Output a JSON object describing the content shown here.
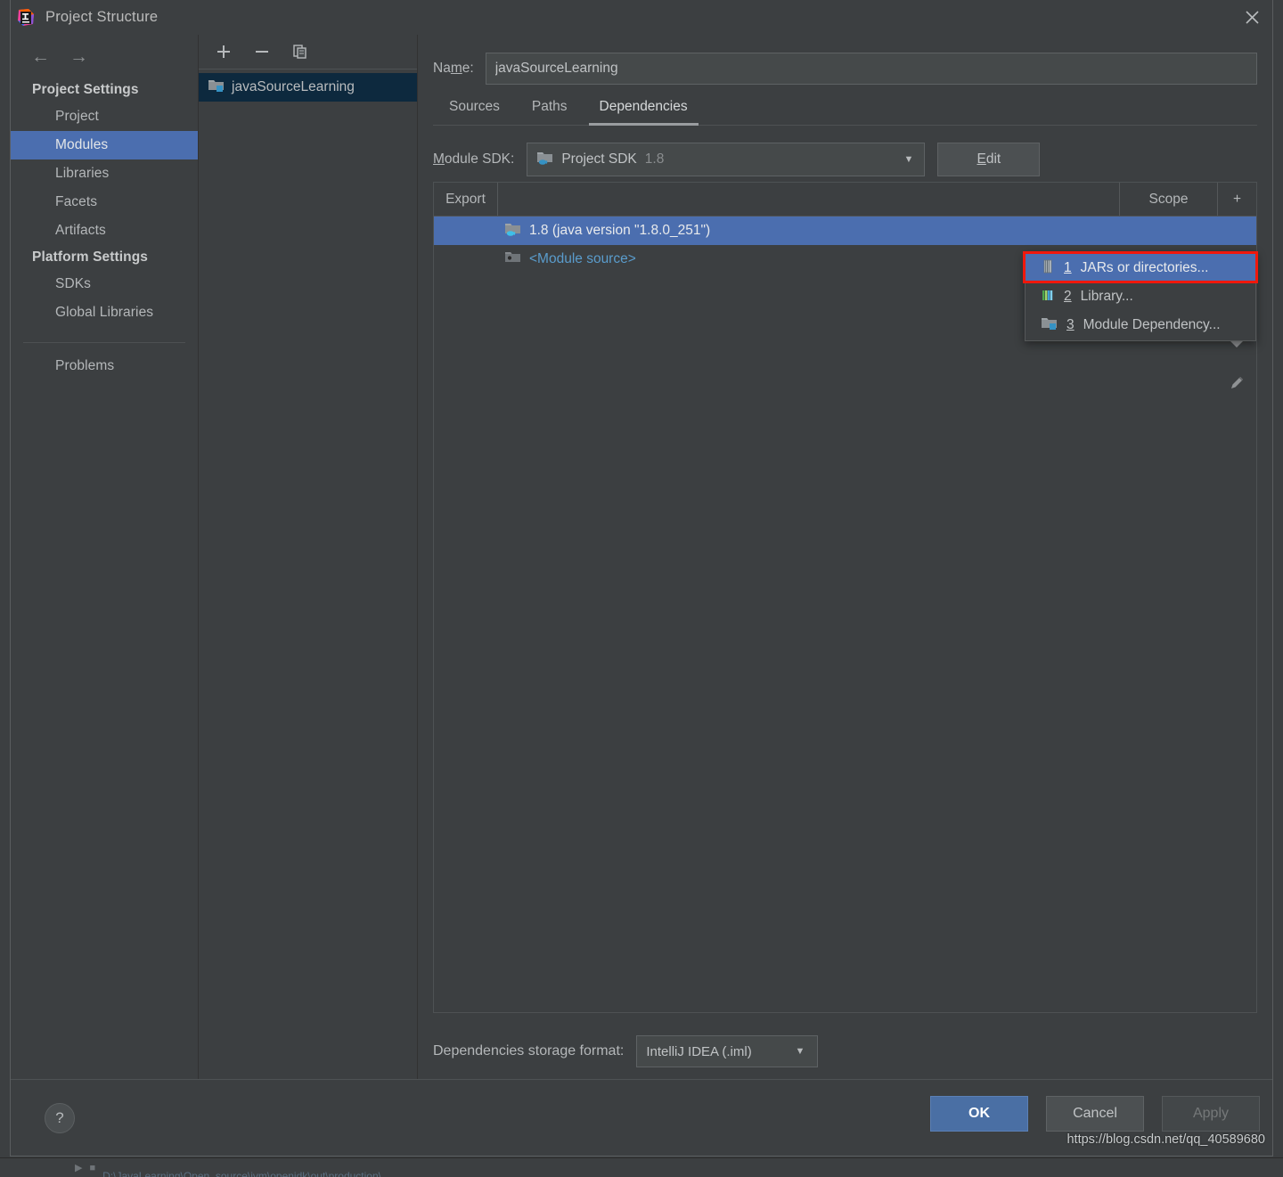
{
  "window": {
    "title": "Project Structure",
    "logo_icon": "intellij-idea-logo",
    "close_icon": "close-icon"
  },
  "sidebar": {
    "back_icon": "arrow-left-icon",
    "forward_icon": "arrow-right-icon",
    "groups": [
      {
        "title": "Project Settings",
        "items": [
          {
            "label": "Project",
            "selected": false
          },
          {
            "label": "Modules",
            "selected": true
          },
          {
            "label": "Libraries",
            "selected": false
          },
          {
            "label": "Facets",
            "selected": false
          },
          {
            "label": "Artifacts",
            "selected": false
          }
        ]
      },
      {
        "title": "Platform Settings",
        "items": [
          {
            "label": "SDKs",
            "selected": false
          },
          {
            "label": "Global Libraries",
            "selected": false
          }
        ]
      }
    ],
    "problems_label": "Problems"
  },
  "module_panel": {
    "toolbar": {
      "add_icon": "plus-icon",
      "remove_icon": "minus-icon",
      "copy_icon": "copy-icon"
    },
    "modules": [
      {
        "label": "javaSourceLearning",
        "icon": "module-folder-icon",
        "selected": true
      }
    ]
  },
  "details": {
    "name_label": "Na",
    "name_label_mnemonic": "m",
    "name_label_rest": "e:",
    "name_value": "javaSourceLearning",
    "tabs": [
      {
        "label": "Sources",
        "active": false
      },
      {
        "label": "Paths",
        "active": false
      },
      {
        "label": "Dependencies",
        "active": true
      }
    ],
    "module_sdk": {
      "label_pre": "",
      "label_mnemonic": "M",
      "label_rest": "odule SDK:",
      "icon": "jdk-folder-icon",
      "value": "Project SDK",
      "version": "1.8",
      "caret_icon": "chevron-down-icon",
      "edit_button": {
        "pre": "",
        "mnemonic": "E",
        "rest": "dit"
      }
    },
    "table": {
      "headers": {
        "export": "Export",
        "middle": "",
        "scope": "Scope",
        "add_icon": "plus-icon"
      },
      "rows": [
        {
          "label": "1.8 (java version \"1.8.0_251\")",
          "icon": "jdk-folder-icon",
          "selected": true,
          "kind": "sdk"
        },
        {
          "label": "<Module source>",
          "icon": "module-source-icon",
          "selected": false,
          "kind": "module-source"
        }
      ]
    },
    "side_rail": {
      "down_icon": "chevron-down-icon",
      "edit_icon": "pencil-icon"
    },
    "add_menu": {
      "items": [
        {
          "number": "1",
          "label": "JARs or directories...",
          "icon": "jar-icon",
          "highlight": true
        },
        {
          "number": "2",
          "label": "Library...",
          "icon": "library-icon",
          "highlight": false
        },
        {
          "number": "3",
          "label": "Module Dependency...",
          "icon": "module-folder-icon",
          "highlight": false
        }
      ],
      "focus_ring_color": "#f0180c"
    },
    "storage": {
      "label": "Dependencies storage format:",
      "value": "IntelliJ IDEA (.iml)",
      "caret_icon": "chevron-down-icon"
    }
  },
  "footer": {
    "help_label": "?",
    "help_icon": "help-icon",
    "ok_label": "OK",
    "cancel_label": "Cancel",
    "apply_label": "Apply"
  },
  "watermark": {
    "text": "https://blog.csdn.net/qq_40589680"
  },
  "ide_background": {
    "run_text": "D:\\JavaLearning\\Open_source\\jvm\\openjdk\\out\\production\\...",
    "run_icon": "run-triangle-icon",
    "module_icon": "module-folder-icon"
  },
  "colors": {
    "dialog_bg": "#3c3f41",
    "selection_blue": "#4b6eaf",
    "module_selection": "#0d293e",
    "accent_red": "#f0180c",
    "ok_blue": "#4a6fa4",
    "link_blue": "#5a9ccc"
  }
}
